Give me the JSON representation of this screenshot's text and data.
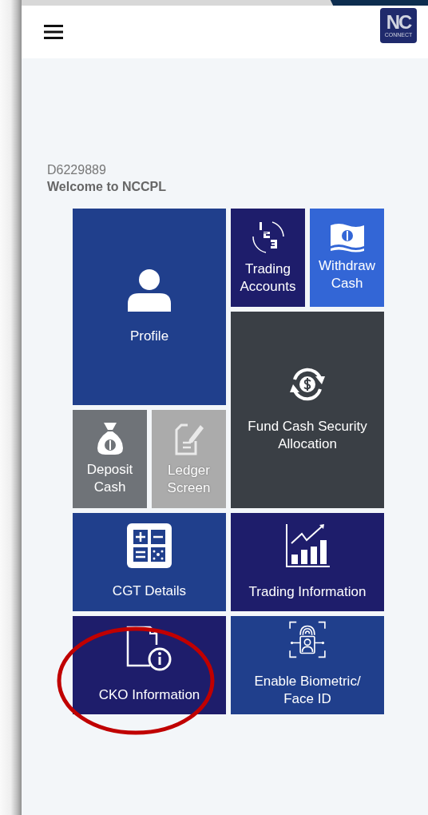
{
  "account_id": "D6229889",
  "welcome": "Welcome to NCCPL",
  "logo": {
    "text": "NC",
    "subtext": "CONNECT"
  },
  "tiles": [
    {
      "kind": "profile",
      "label": "Profile",
      "color": "#203f8c",
      "disabled": false
    },
    {
      "kind": "accounts",
      "label": "Trading Accounts",
      "color": "#1e1d6b",
      "disabled": false
    },
    {
      "kind": "withdraw",
      "label": "Withdraw Cash",
      "color": "#3366d6",
      "disabled": false
    },
    {
      "kind": "fund",
      "label": "Fund Cash Security Allocation",
      "color": "#3a3f45",
      "disabled": false
    },
    {
      "kind": "deposit",
      "label": "Deposit Cash",
      "color": "#6f7378",
      "disabled": false
    },
    {
      "kind": "ledger",
      "label": "Ledger Screen",
      "color": "#ababab",
      "disabled": true
    },
    {
      "kind": "cgt",
      "label": "CGT Details",
      "color": "#203f8c",
      "disabled": false
    },
    {
      "kind": "tradinginfo",
      "label": "Trading Information",
      "color": "#1e1d6b",
      "disabled": false
    },
    {
      "kind": "cko",
      "label": "CKO Information",
      "color": "#1e1d6b",
      "disabled": false
    },
    {
      "kind": "biometric",
      "label": "Enable Biometric/ Face ID",
      "color": "#203f8c",
      "disabled": false
    }
  ]
}
